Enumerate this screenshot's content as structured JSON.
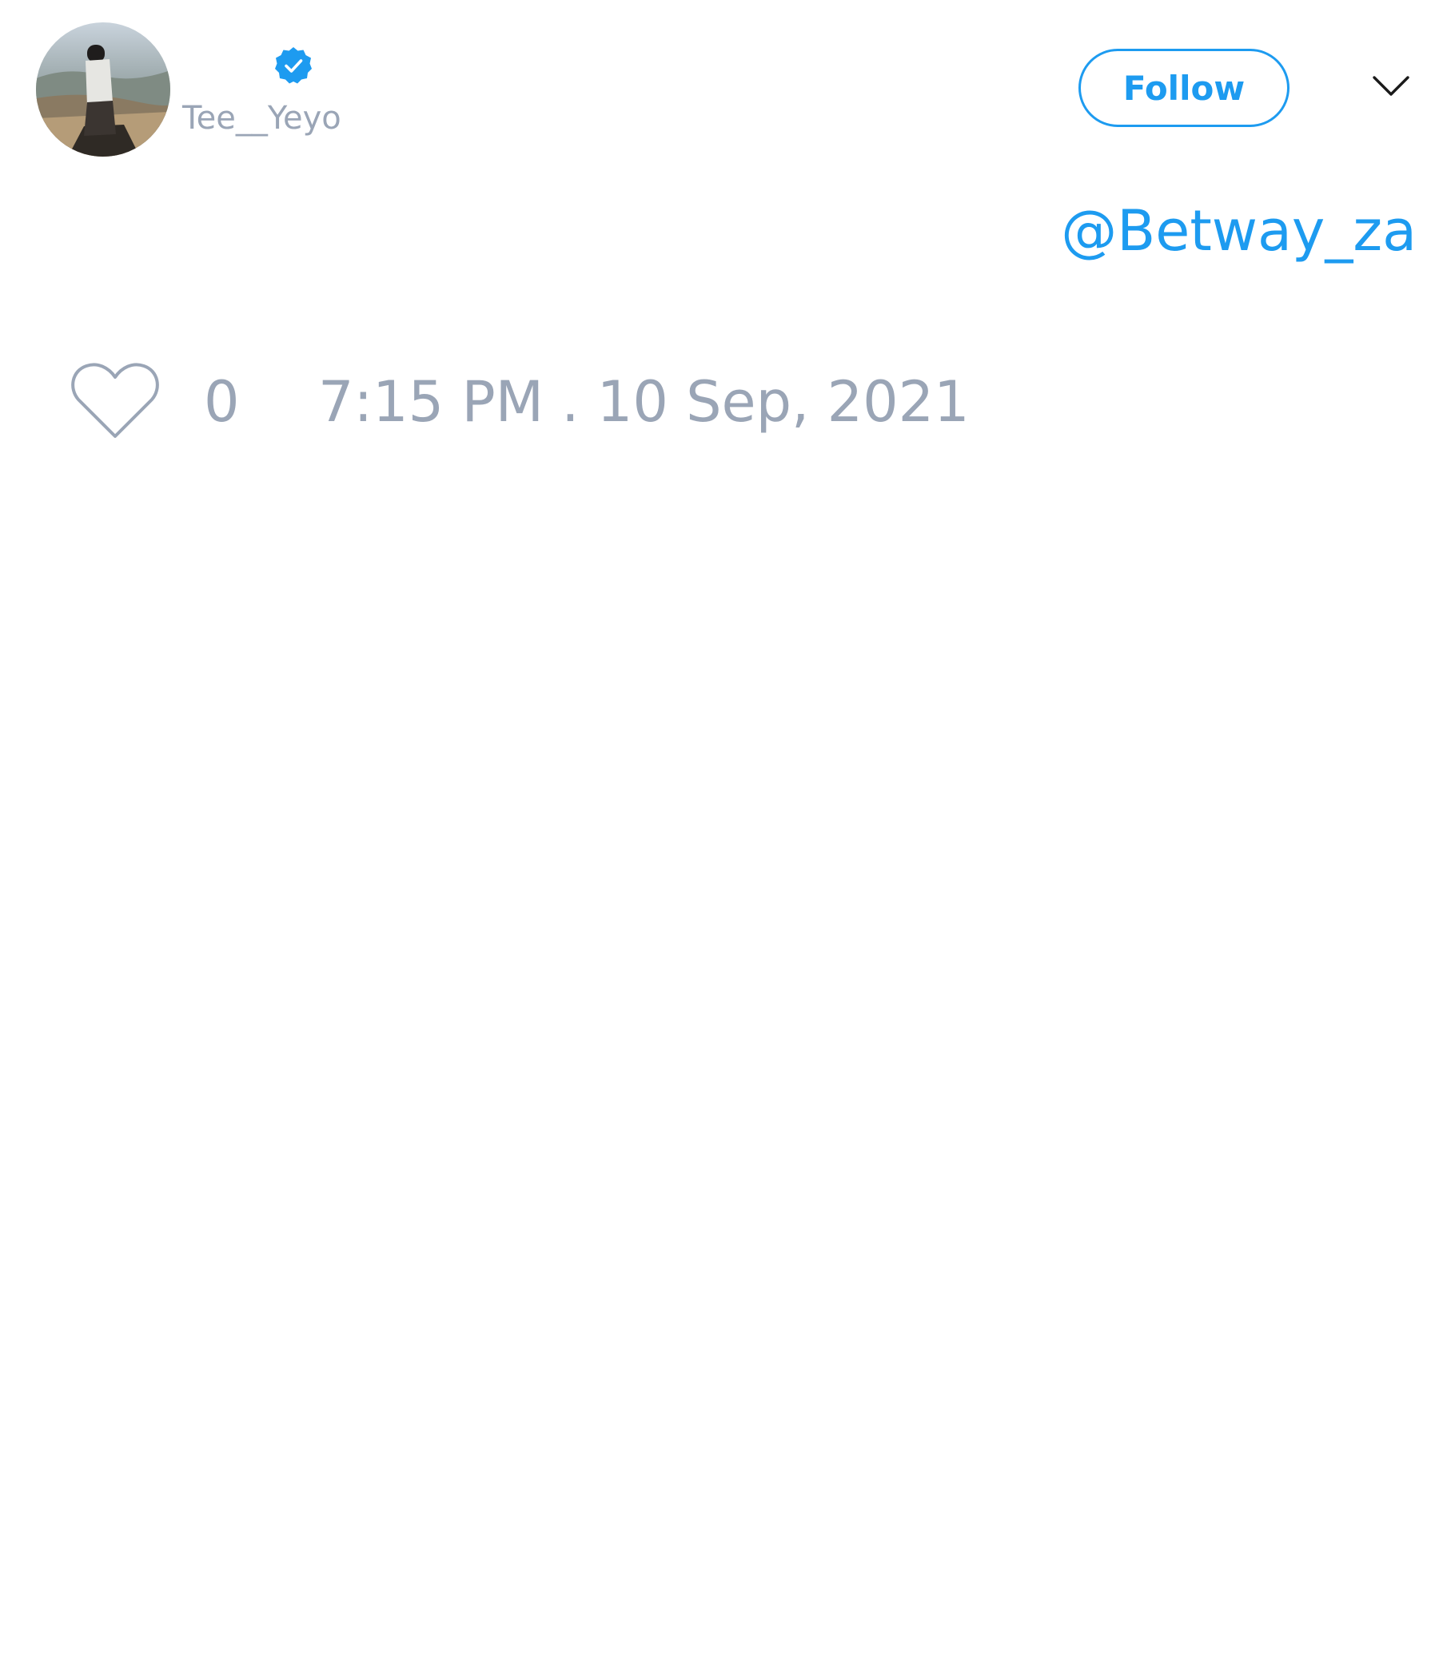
{
  "author": {
    "display_name": "",
    "handle": "Tee__Yeyo",
    "verified": true,
    "avatar": "profile-photo"
  },
  "header": {
    "follow_label": "Follow",
    "menu_icon": "chevron-down-icon"
  },
  "tweet": {
    "text": "@Betway_za"
  },
  "footer": {
    "like_icon": "heart-outline-icon",
    "like_count": "0",
    "timestamp": "7:15 PM . 10 Sep, 2021"
  },
  "colors": {
    "accent": "#1d9bf0",
    "muted_text": "#9aa5b6",
    "background": "#ffffff"
  }
}
